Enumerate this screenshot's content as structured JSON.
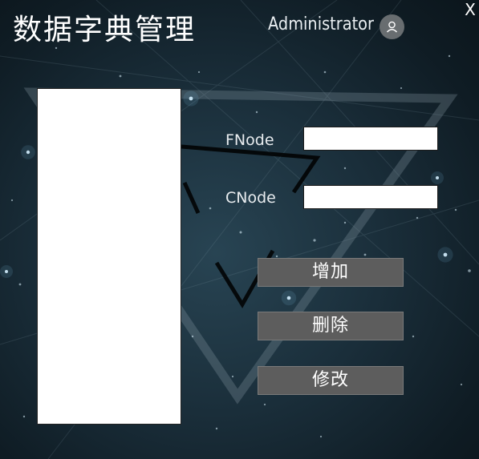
{
  "window": {
    "title": "数据字典管理",
    "close_label": "X"
  },
  "user": {
    "name": "Administrator",
    "avatar_icon": "user-icon"
  },
  "form": {
    "fnode_label": "FNode",
    "fnode_value": "",
    "cnode_label": "CNode",
    "cnode_value": ""
  },
  "actions": {
    "add_label": "增加",
    "delete_label": "删除",
    "edit_label": "修改"
  },
  "tree": {
    "items": []
  },
  "colors": {
    "background": "#1a2e3a",
    "button": "#5d5d5d",
    "text": "#ffffff"
  }
}
